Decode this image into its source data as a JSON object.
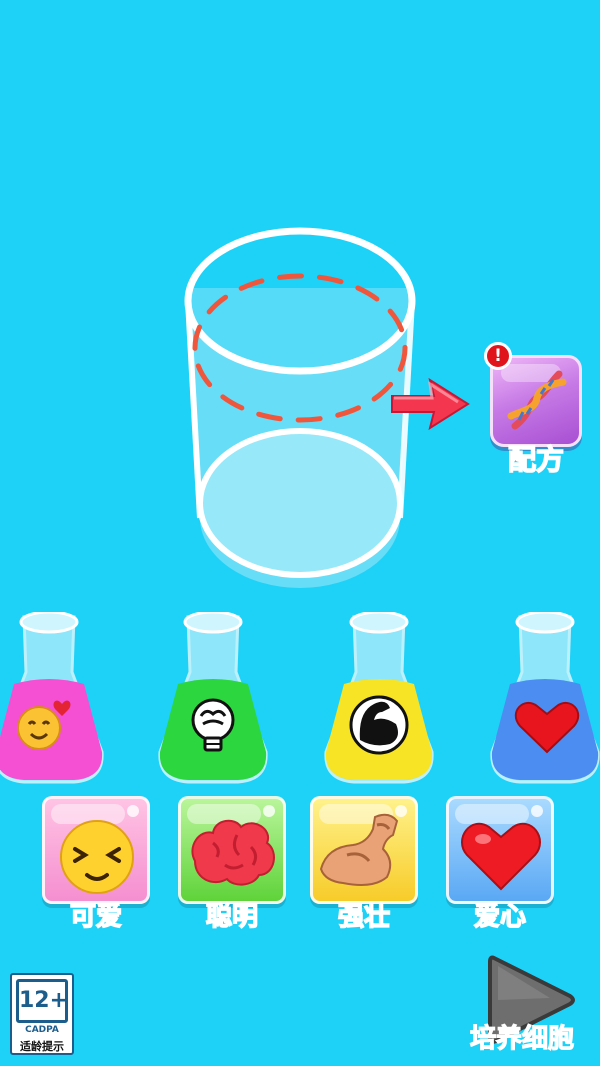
{
  "recipe": {
    "label": "配方",
    "alert": "!"
  },
  "flasks": [
    {
      "liquid_color": "#F54FD4",
      "icon": "smiling-face-icon"
    },
    {
      "liquid_color": "#2CD63E",
      "icon": "brain-bulb-icon"
    },
    {
      "liquid_color": "#F7E424",
      "icon": "flexed-arm-icon"
    },
    {
      "liquid_color": "#4C8DF2",
      "icon": "heart-icon"
    }
  ],
  "traits": [
    {
      "label": "可爱",
      "icon": "squinting-face-icon"
    },
    {
      "label": "聪明",
      "icon": "brain-icon"
    },
    {
      "label": "强壮",
      "icon": "muscle-arm-icon"
    },
    {
      "label": "爱心",
      "icon": "red-heart-icon"
    }
  ],
  "age_rating": {
    "value": "12+",
    "org": "CADPA",
    "tip": "适龄提示"
  },
  "play": {
    "label": "培养细胞",
    "icon": "play-triangle-icon"
  }
}
